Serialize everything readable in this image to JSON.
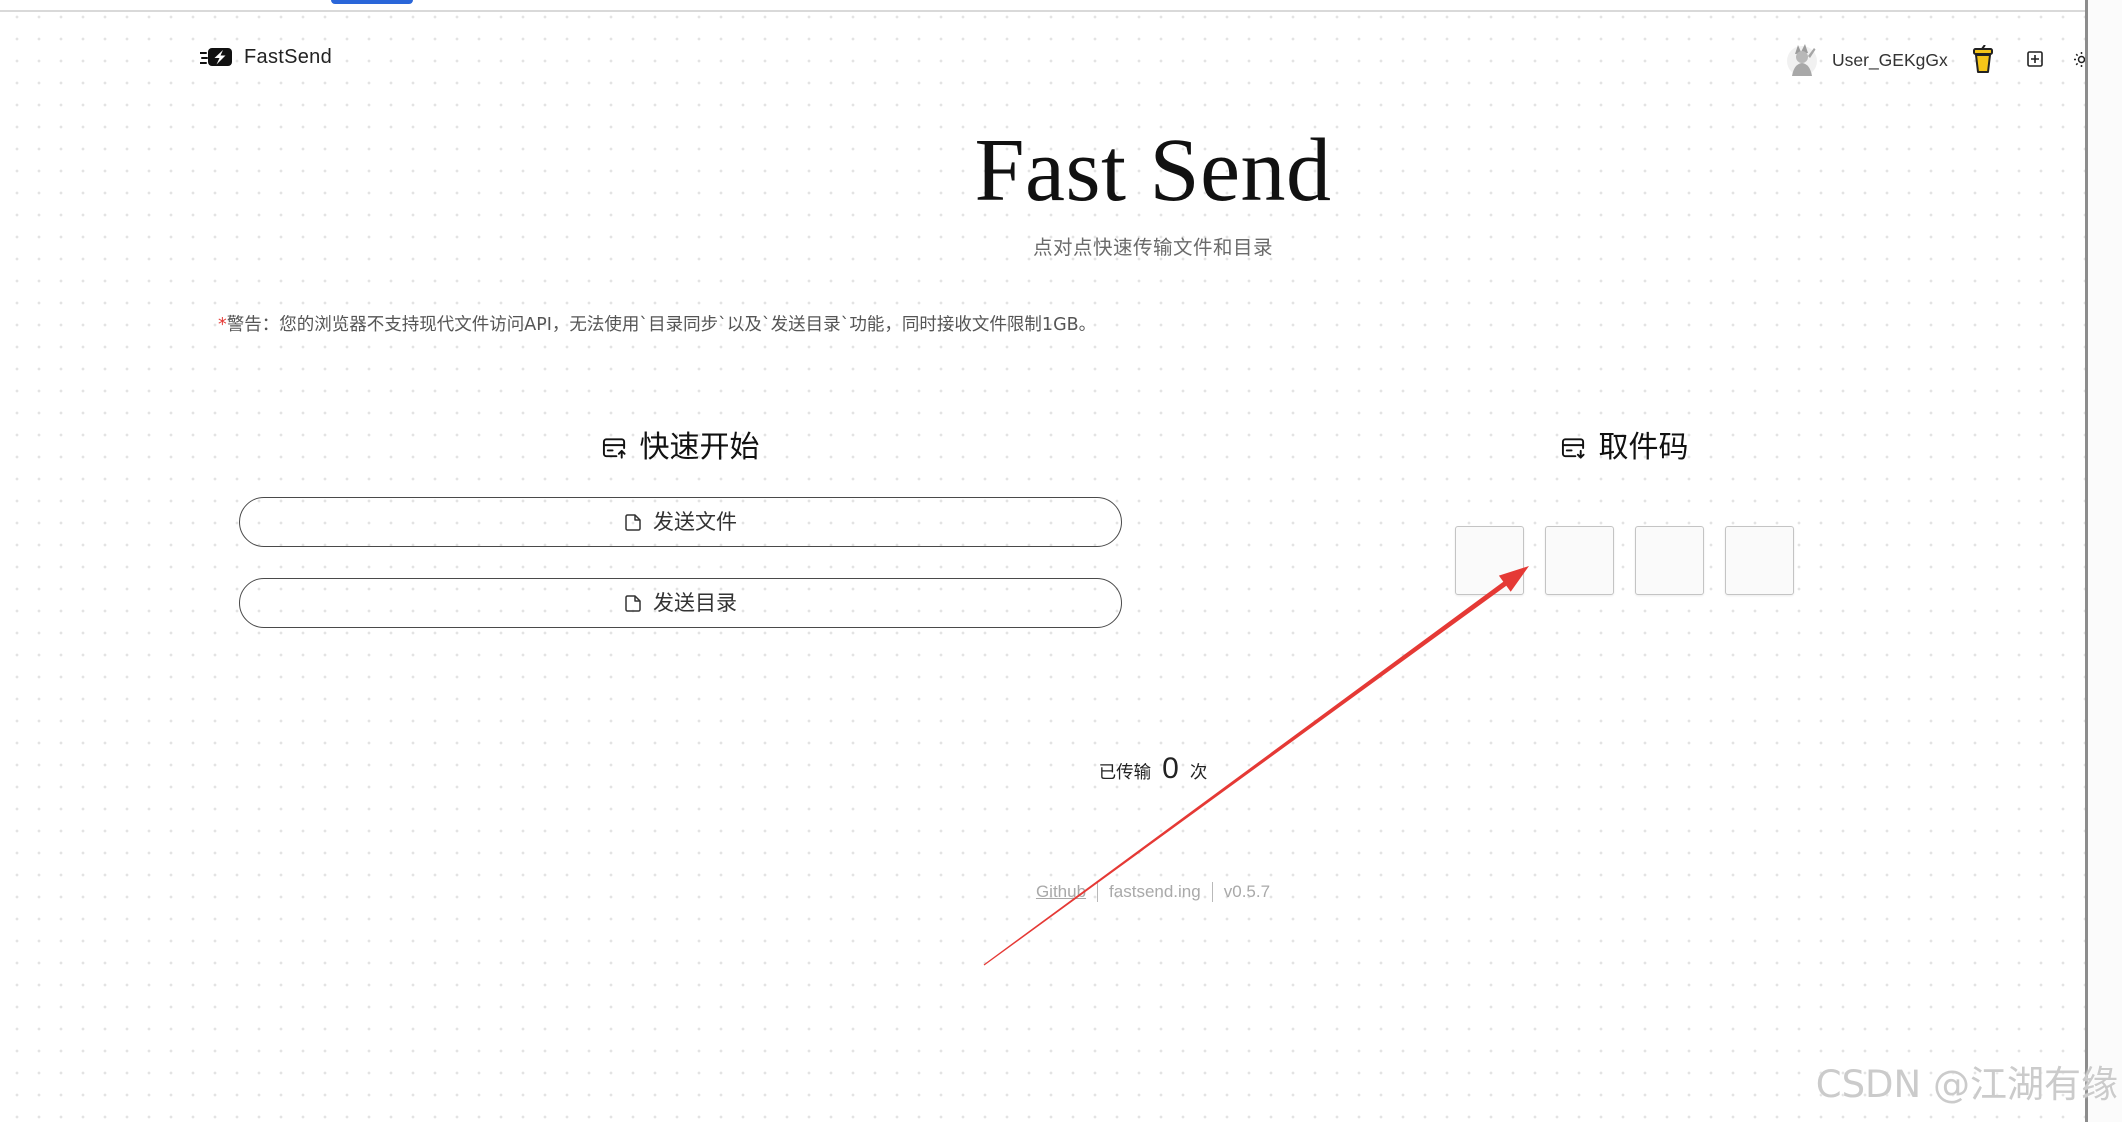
{
  "app": {
    "logo_text": "FastSend"
  },
  "header": {
    "username": "User_GEKgGx"
  },
  "hero": {
    "title": "Fast Send",
    "subtitle": "点对点快速传输文件和目录"
  },
  "warning": {
    "asterisk": "*",
    "text": "警告：您的浏览器不支持现代文件访问API，无法使用`目录同步`以及`发送目录`功能，同时接收文件限制1GB。"
  },
  "quick_start": {
    "title": "快速开始",
    "send_file_label": "发送文件",
    "send_directory_label": "发送目录"
  },
  "pickup": {
    "title": "取件码",
    "code_inputs": [
      "",
      "",
      "",
      ""
    ]
  },
  "stats": {
    "prefix": "已传输",
    "count": "0",
    "suffix": "次"
  },
  "footer": {
    "github_link": "Github",
    "site": "fastsend.ing",
    "version": "v0.5.7"
  },
  "watermark": "CSDN @江湖有缘",
  "icons": {
    "logo": "lightning-box-icon",
    "avatar": "user-avatar-icon",
    "donate": "drink-cup-icon",
    "layout": "grid-icon",
    "theme": "sun-icon",
    "quick_start": "send-card-icon",
    "pickup": "receive-card-icon",
    "send_file": "file-icon",
    "send_directory": "file-icon"
  },
  "colors": {
    "annotation_arrow": "#e53935",
    "warning_asterisk": "#e53935",
    "blue_tab": "#2a66d9",
    "cup_fill": "#f5c518"
  }
}
